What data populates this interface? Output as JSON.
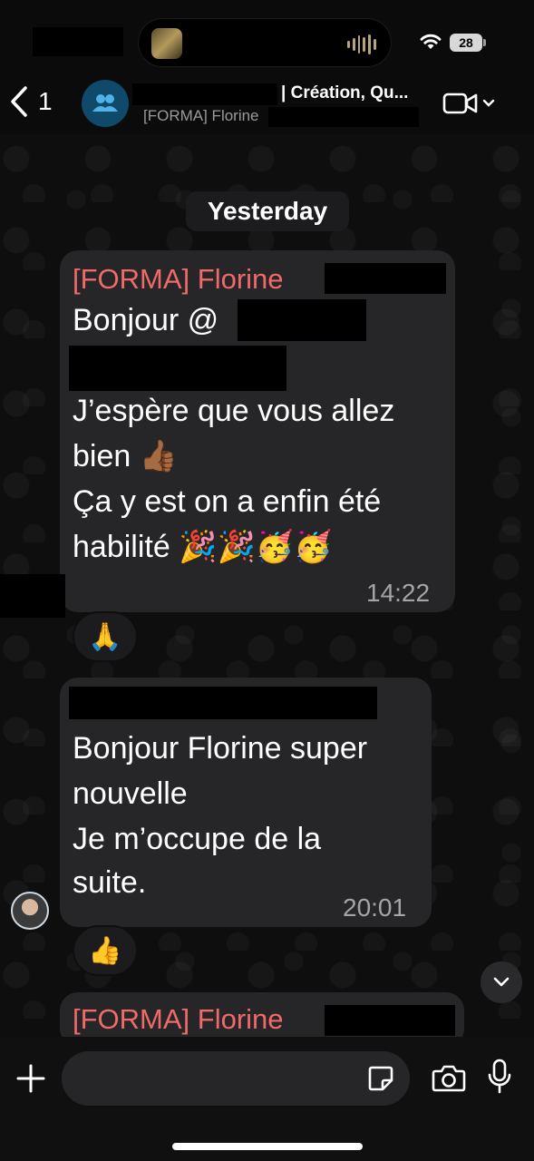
{
  "status_bar": {
    "battery_level": "28",
    "icons": [
      "media-thumb-icon",
      "audio-wave-icon",
      "wifi-icon",
      "battery-icon"
    ]
  },
  "header": {
    "back_count": "1",
    "title": "| Création, Qu...",
    "subtitle": "[FORMA] Florine",
    "icons": [
      "chevron-left-icon",
      "group-icon",
      "video-camera-icon",
      "chevron-down-icon"
    ]
  },
  "chat": {
    "date_separator": "Yesterday",
    "messages": [
      {
        "sender": "[FORMA] Florine",
        "lines": [
          "Bonjour @",
          "J’espère que vous allez",
          "bien 👍🏾",
          "Ça y est on a enfin été",
          "habilité 🎉🎉🥳🥳"
        ],
        "time": "14:22",
        "reaction": "🙏"
      },
      {
        "sender": "",
        "lines": [
          "Bonjour Florine super",
          "nouvelle",
          "Je m’occupe de la",
          "suite."
        ],
        "time": "20:01",
        "reaction": "👍"
      },
      {
        "sender": "[FORMA] Florine",
        "lines": [],
        "time": ""
      }
    ]
  },
  "composer": {
    "placeholder": "",
    "icons": [
      "plus-icon",
      "sticker-icon",
      "camera-icon",
      "microphone-icon"
    ]
  },
  "colors": {
    "background": "#0b0b0b",
    "bubble": "#262628",
    "sender_name": "#f06a6a",
    "mention": "#2ec36b",
    "group_avatar": "#0f4a6a"
  }
}
